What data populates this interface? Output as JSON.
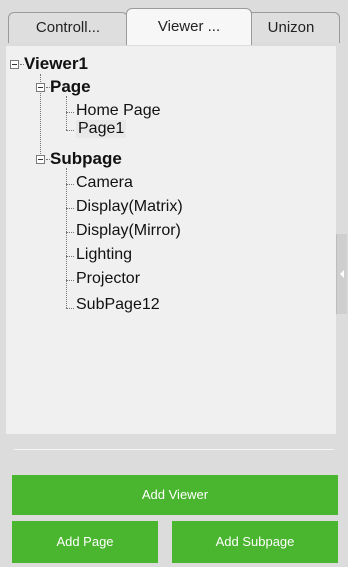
{
  "tabs": [
    {
      "label": "Controll..."
    },
    {
      "label": "Viewer ..."
    },
    {
      "label": "Unizon"
    }
  ],
  "tree": {
    "root": "Viewer1",
    "page_group": "Page",
    "pages": [
      "Home Page",
      "Page1"
    ],
    "subpage_group": "Subpage",
    "subpages": [
      "Camera",
      "Display(Matrix)",
      "Display(Mirror)",
      "Lighting",
      "Projector",
      "SubPage12"
    ]
  },
  "buttons": {
    "add_viewer": "Add Viewer",
    "add_page": "Add Page",
    "add_subpage": "Add Subpage"
  },
  "colors": {
    "button_green": "#4ab52e",
    "panel_bg": "#dcdcdc",
    "tree_bg": "#f0f0f0"
  },
  "selected_item": "Page1"
}
